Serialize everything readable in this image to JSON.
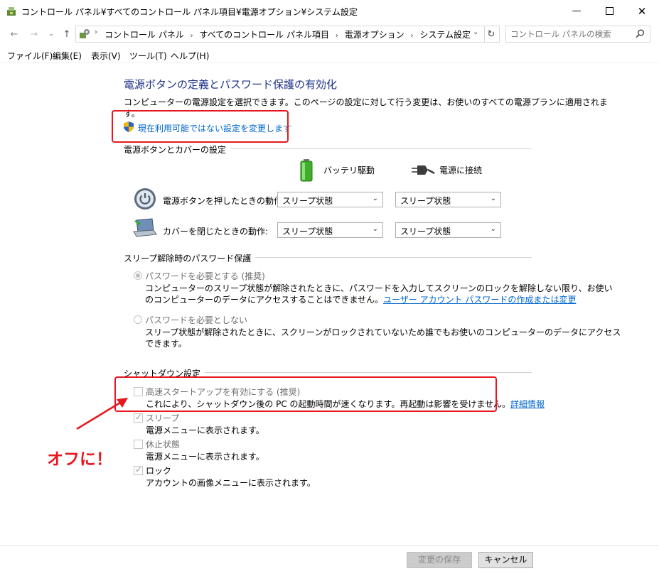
{
  "window": {
    "title": "コントロール パネル¥すべてのコントロール パネル項目¥電源オプション¥システム設定",
    "minimize_icon": "minimize-icon",
    "maximize_icon": "maximize-icon",
    "close_icon": "close-icon"
  },
  "address": {
    "breadcrumbs": [
      "コントロール パネル",
      "すべてのコントロール パネル項目",
      "電源オプション",
      "システム設定"
    ],
    "search_placeholder": "コントロール パネルの検索"
  },
  "menu": [
    "ファイル(F)",
    "編集(E)",
    "表示(V)",
    "ツール(T)",
    "ヘルプ(H)"
  ],
  "page": {
    "title": "電源ボタンの定義とパスワード保護の有効化",
    "description_line1": "コンピューターの電源設定を選択できます。このページの設定に対して行う変更は、お使いのすべての電源プランに適用されま",
    "description_line2": "す。",
    "change_settings_link": "現在利用可能ではない設定を変更します"
  },
  "power_buttons": {
    "section_title": "電源ボタンとカバーの設定",
    "battery_label": "バッテリ駆動",
    "plugged_label": "電源に接続",
    "rows": [
      {
        "label": "電源ボタンを押したときの動作:",
        "battery": "スリープ状態",
        "plugged": "スリープ状態"
      },
      {
        "label": "カバーを閉じたときの動作:",
        "battery": "スリープ状態",
        "plugged": "スリープ状態"
      }
    ]
  },
  "password": {
    "section_title": "スリープ解除時のパスワード保護",
    "opt1_label": "パスワードを必要とする (推奨)",
    "opt1_desc1": "コンピューターのスリープ状態が解除されたときに、パスワードを入力してスクリーンのロックを解除しない限り、お使い",
    "opt1_desc2": "のコンピューターのデータにアクセスすることはできません。",
    "opt1_link": "ユーザー アカウント パスワードの作成または変更",
    "opt2_label": "パスワードを必要としない",
    "opt2_desc1": "スリープ状態が解除されたときに、スクリーンがロックされていないため誰でもお使いのコンピューターのデータにアクセス",
    "opt2_desc2": "できます。"
  },
  "shutdown": {
    "section_title": "シャットダウン設定",
    "items": [
      {
        "label": "高速スタートアップを有効にする (推奨)",
        "desc": "これにより、シャットダウン後の PC の起動時間が速くなります。再起動は影響を受けません。",
        "link": "詳細情報",
        "checked": false
      },
      {
        "label": "スリープ",
        "desc": "電源メニューに表示されます。",
        "checked": true
      },
      {
        "label": "休止状態",
        "desc": "電源メニューに表示されます。",
        "checked": false
      },
      {
        "label": "ロック",
        "desc": "アカウントの画像メニューに表示されます。",
        "checked": true
      }
    ]
  },
  "annotation": {
    "note": "オフに！",
    "color": "#e8171f"
  },
  "buttons": {
    "save": "変更の保存",
    "cancel": "キャンセル"
  }
}
